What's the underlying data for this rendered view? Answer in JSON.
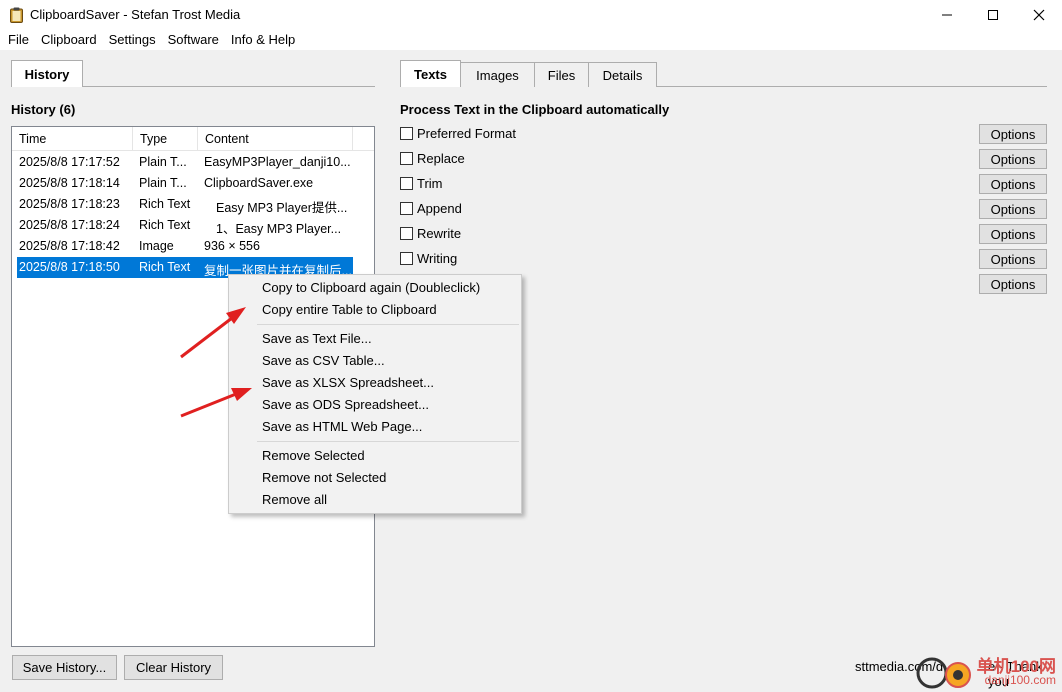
{
  "window": {
    "title": "ClipboardSaver - Stefan Trost Media",
    "minimize": "—",
    "maximize": "☐",
    "close": "✕"
  },
  "menu": [
    "File",
    "Clipboard",
    "Settings",
    "Software",
    "Info & Help"
  ],
  "left_tabs": [
    "History"
  ],
  "right_tabs": [
    "Texts",
    "Images",
    "Files",
    "Details"
  ],
  "history": {
    "title": "History (6)",
    "columns": [
      "Time",
      "Type",
      "Content"
    ],
    "rows": [
      {
        "time": "2025/8/8 17:17:52",
        "type": "Plain T...",
        "content": "EasyMP3Player_danji10..."
      },
      {
        "time": "2025/8/8 17:18:14",
        "type": "Plain T...",
        "content": "ClipboardSaver.exe"
      },
      {
        "time": "2025/8/8 17:18:23",
        "type": "Rich Text",
        "content": "Easy MP3 Player提供..."
      },
      {
        "time": "2025/8/8 17:18:24",
        "type": "Rich Text",
        "content": "1、Easy MP3 Player..."
      },
      {
        "time": "2025/8/8 17:18:42",
        "type": "Image",
        "content": "936 × 556"
      },
      {
        "time": "2025/8/8 17:18:50",
        "type": "Rich Text",
        "content": "复制一张图片并在复制后..."
      }
    ],
    "save_button": "Save History...",
    "clear_button": "Clear History"
  },
  "process": {
    "title": "Process Text in the Clipboard automatically",
    "options": [
      "Preferred Format",
      "Replace",
      "Trim",
      "Append",
      "Rewrite",
      "Writing"
    ],
    "options_button": "Options"
  },
  "context_menu": {
    "group1": [
      "Copy to Clipboard again (Doubleclick)",
      "Copy entire Table to Clipboard"
    ],
    "group2": [
      "Save as Text File...",
      "Save as CSV Table...",
      "Save as XLSX Spreadsheet...",
      "Save as ODS Spreadsheet...",
      "Save as HTML Web Page..."
    ],
    "group3": [
      "Remove Selected",
      "Remove not Selected",
      "Remove all"
    ]
  },
  "footer": {
    "text": "sttmedia.com/d",
    "thanks": "e - Thank you"
  },
  "watermark": {
    "text": "单机100网",
    "url": "danji100.com"
  },
  "colors": {
    "selection": "#0078d7",
    "arrow": "#e02020"
  }
}
